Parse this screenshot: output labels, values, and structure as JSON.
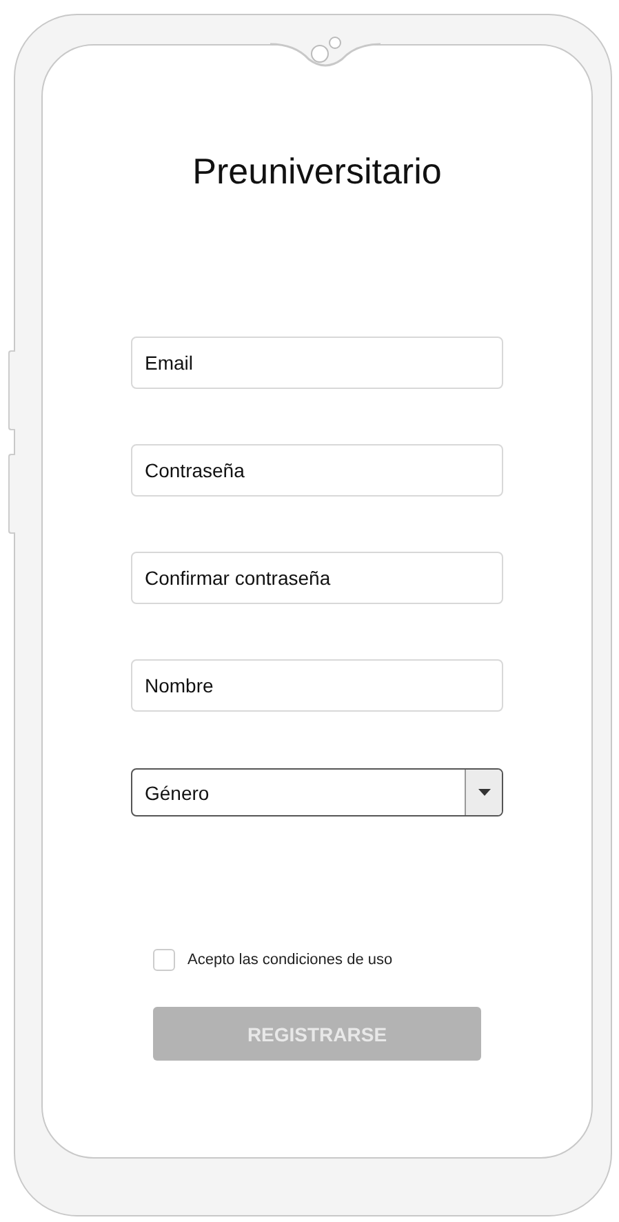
{
  "title": "Preuniversitario",
  "fields": [
    {
      "kind": "input",
      "placeholder": "Email"
    },
    {
      "kind": "input",
      "placeholder": "Contraseña"
    },
    {
      "kind": "input",
      "placeholder": "Confirmar contraseña"
    },
    {
      "kind": "input",
      "placeholder": "Nombre"
    },
    {
      "kind": "select",
      "placeholder": "Género"
    }
  ],
  "terms": {
    "label": "Acepto las condiciones de uso",
    "checked": false
  },
  "submit": {
    "label": "REGISTRARSE",
    "disabled": true
  }
}
